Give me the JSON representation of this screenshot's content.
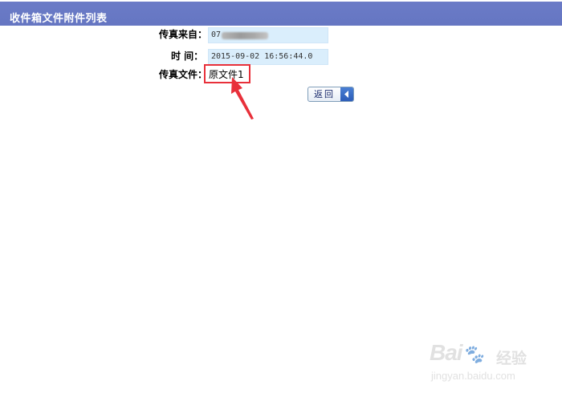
{
  "header": {
    "title": "收件箱文件附件列表"
  },
  "details": {
    "from_label": "传真来自：",
    "from_value": "07",
    "time_label": "时 间：",
    "time_value": "2015-09-02 16:56:44.0",
    "file_label": "传真文件：",
    "file_name": "原文件1"
  },
  "actions": {
    "back_label": "返回"
  },
  "watermark": {
    "logo": "Bai",
    "logo_suffix": "经验",
    "url": "jingyan.baidu.com"
  },
  "colors": {
    "header_bg": "#6576c2",
    "value_bg": "#daeefc",
    "highlight": "#e8303a",
    "button_arrow": "#2b5cb8"
  },
  "icons": {
    "back": "chevron-left-icon",
    "annotation": "red-arrow-icon"
  }
}
